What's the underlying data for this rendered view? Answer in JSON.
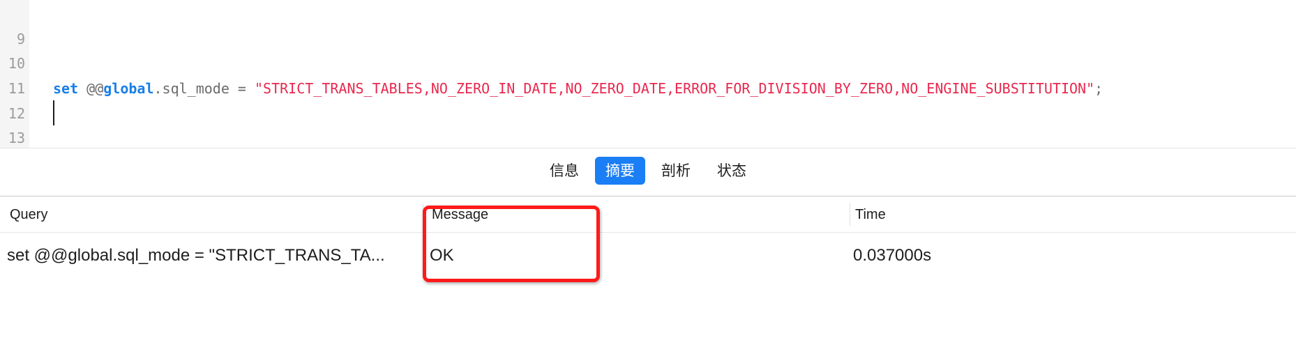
{
  "editor": {
    "lines": [
      {
        "number": "9",
        "keyword": "",
        "middle": "",
        "keyword2": "",
        "rest": "",
        "string": "",
        "end": ""
      },
      {
        "number": "10",
        "keyword": "set",
        "middle": " @@",
        "keyword2": "global",
        "rest": ".sql_mode = ",
        "string": "\"STRICT_TRANS_TABLES,NO_ZERO_IN_DATE,NO_ZERO_DATE,ERROR_FOR_DIVISION_BY_ZERO,NO_ENGINE_SUBSTITUTION\"",
        "end": ";"
      },
      {
        "number": "11"
      },
      {
        "number": "12"
      },
      {
        "number": "13"
      }
    ]
  },
  "tabs": [
    {
      "label": "信息",
      "active": false
    },
    {
      "label": "摘要",
      "active": true
    },
    {
      "label": "剖析",
      "active": false
    },
    {
      "label": "状态",
      "active": false
    }
  ],
  "result": {
    "headers": {
      "query": "Query",
      "message": "Message",
      "time": "Time"
    },
    "rows": [
      {
        "query": "set @@global.sql_mode = \"STRICT_TRANS_TA...",
        "message": "OK",
        "time": "0.037000s"
      }
    ]
  },
  "colors": {
    "keyword": "#1a7ee6",
    "string": "#e8284e",
    "active_tab": "#1a7ef5",
    "highlight": "#ff1a1a"
  }
}
